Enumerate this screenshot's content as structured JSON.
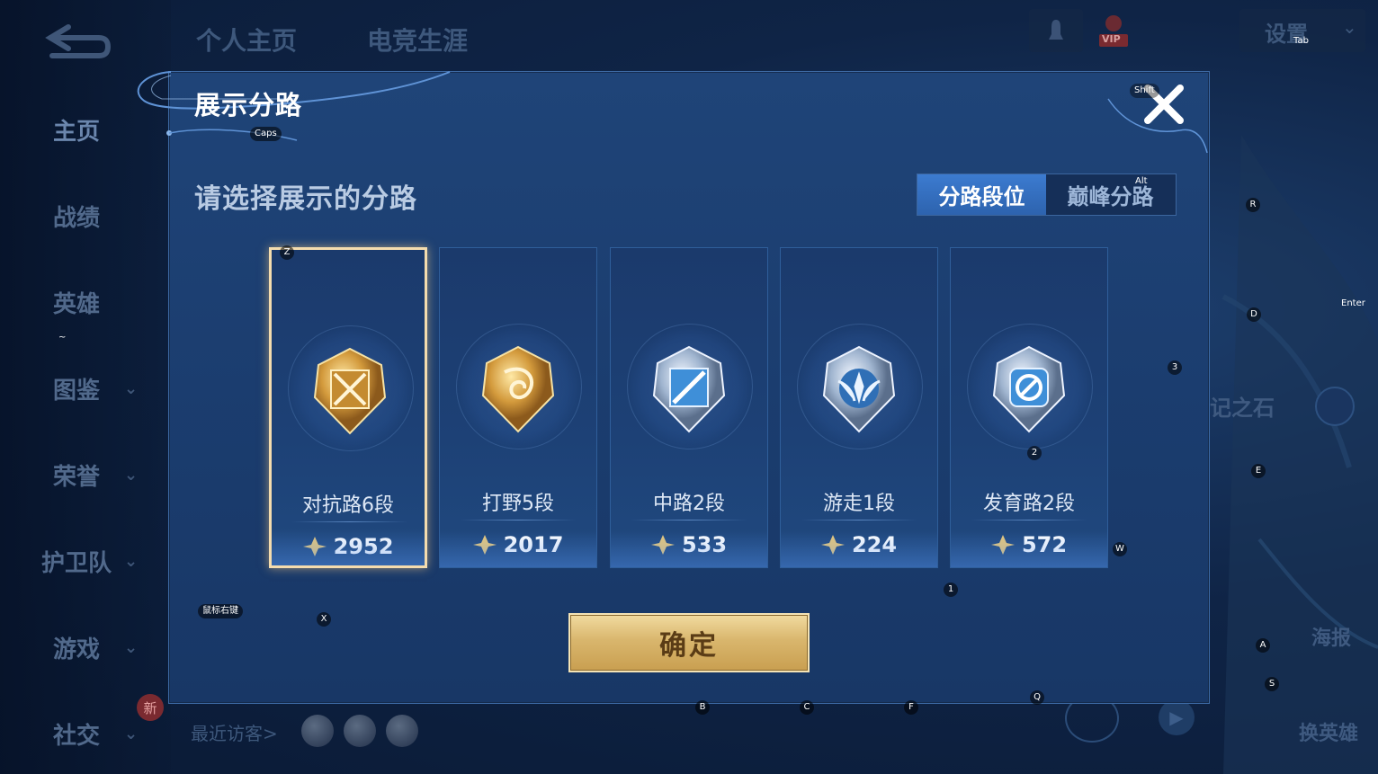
{
  "nav": {
    "top_tabs": [
      "个人主页",
      "电竞生涯"
    ],
    "items": [
      {
        "label": "主页",
        "has_chevron": false
      },
      {
        "label": "战绩",
        "has_chevron": false
      },
      {
        "label": "英雄",
        "has_chevron": false
      },
      {
        "label": "图鉴",
        "has_chevron": true
      },
      {
        "label": "荣誉",
        "has_chevron": true
      },
      {
        "label": "护卫队",
        "has_chevron": true
      },
      {
        "label": "游戏",
        "has_chevron": true
      },
      {
        "label": "社交",
        "has_chevron": true
      }
    ],
    "new_badge": "新",
    "recent_visitors": "最近访客>",
    "vip_label": "VIP",
    "settings_label": "设置"
  },
  "right_panel": {
    "stone_text": "记之石",
    "poster_label": "海报",
    "switch_hero_label": "换英雄"
  },
  "dialog": {
    "title": "展示分路",
    "prompt": "请选择展示的分路",
    "segments": [
      {
        "label": "分路段位",
        "active": true
      },
      {
        "label": "巅峰分路",
        "active": false
      }
    ],
    "cards": [
      {
        "rank": "对抗路6段",
        "score": "2952",
        "emblem": "gold",
        "icon": "swords-icon",
        "selected": true
      },
      {
        "rank": "打野5段",
        "score": "2017",
        "emblem": "gold",
        "icon": "dragon-icon",
        "selected": false
      },
      {
        "rank": "中路2段",
        "score": "533",
        "emblem": "silver",
        "icon": "blade-icon",
        "selected": false
      },
      {
        "rank": "游走1段",
        "score": "224",
        "emblem": "silver",
        "icon": "wings-icon",
        "selected": false
      },
      {
        "rank": "发育路2段",
        "score": "572",
        "emblem": "silver",
        "icon": "target-icon",
        "selected": false
      }
    ],
    "confirm_label": "确定"
  },
  "key_hints": {
    "tab": "Tab",
    "shift": "Shift",
    "caps": "Caps",
    "alt": "Alt",
    "enter": "Enter",
    "mouse_right": "鼠标右键",
    "tilde": "~",
    "z": "Z",
    "x": "X",
    "b": "B",
    "c": "C",
    "f": "F",
    "q": "Q",
    "w": "W",
    "r": "R",
    "d": "D",
    "e": "E",
    "a": "A",
    "s": "S",
    "k1": "1",
    "k2": "2",
    "k3": "3"
  },
  "colors": {
    "accent_blue": "#3c7bd0",
    "gold_button": "#d9b66d",
    "selected_border": "#f4dcae"
  }
}
